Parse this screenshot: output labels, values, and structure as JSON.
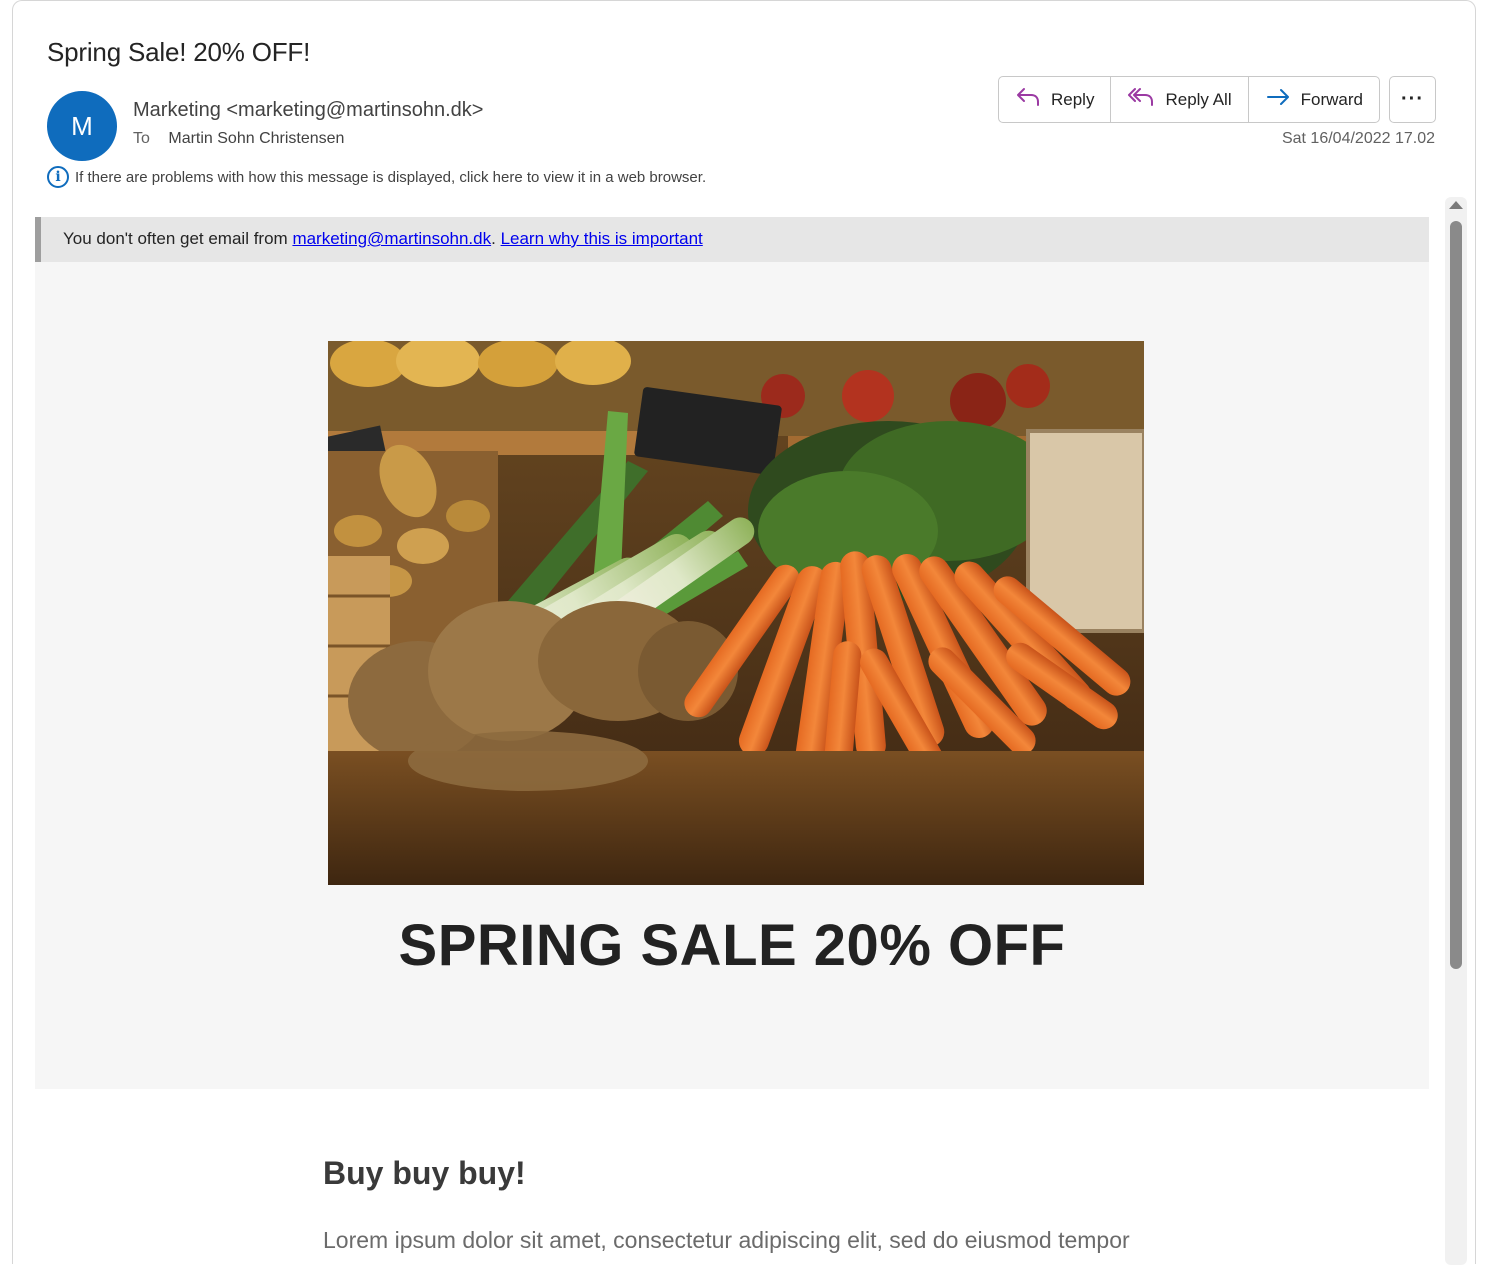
{
  "email": {
    "subject": "Spring Sale! 20% OFF!",
    "avatar_initial": "M",
    "sender": "Marketing <marketing@martinsohn.dk>",
    "to_label": "To",
    "recipient": "Martin Sohn Christensen",
    "date": "Sat 16/04/2022 17.02",
    "info_notice": "If there are problems with how this message is displayed, click here to view it in a web browser."
  },
  "actions": {
    "reply": "Reply",
    "reply_all": "Reply All",
    "forward": "Forward",
    "more": "···"
  },
  "banner": {
    "prefix": "You don't often get email from ",
    "sender_link": "marketing@martinsohn.dk",
    "separator": ". ",
    "learn_link": "Learn why this is important"
  },
  "body": {
    "headline": "SPRING SALE 20% OFF",
    "heading": "Buy buy buy!",
    "paragraph": "Lorem ipsum dolor sit amet, consectetur adipiscing elit, sed do eiusmod tempor"
  },
  "colors": {
    "accent": "#0f6cbd",
    "reply_icon": "#9b3aa3",
    "forward_icon": "#0f6cbd"
  }
}
